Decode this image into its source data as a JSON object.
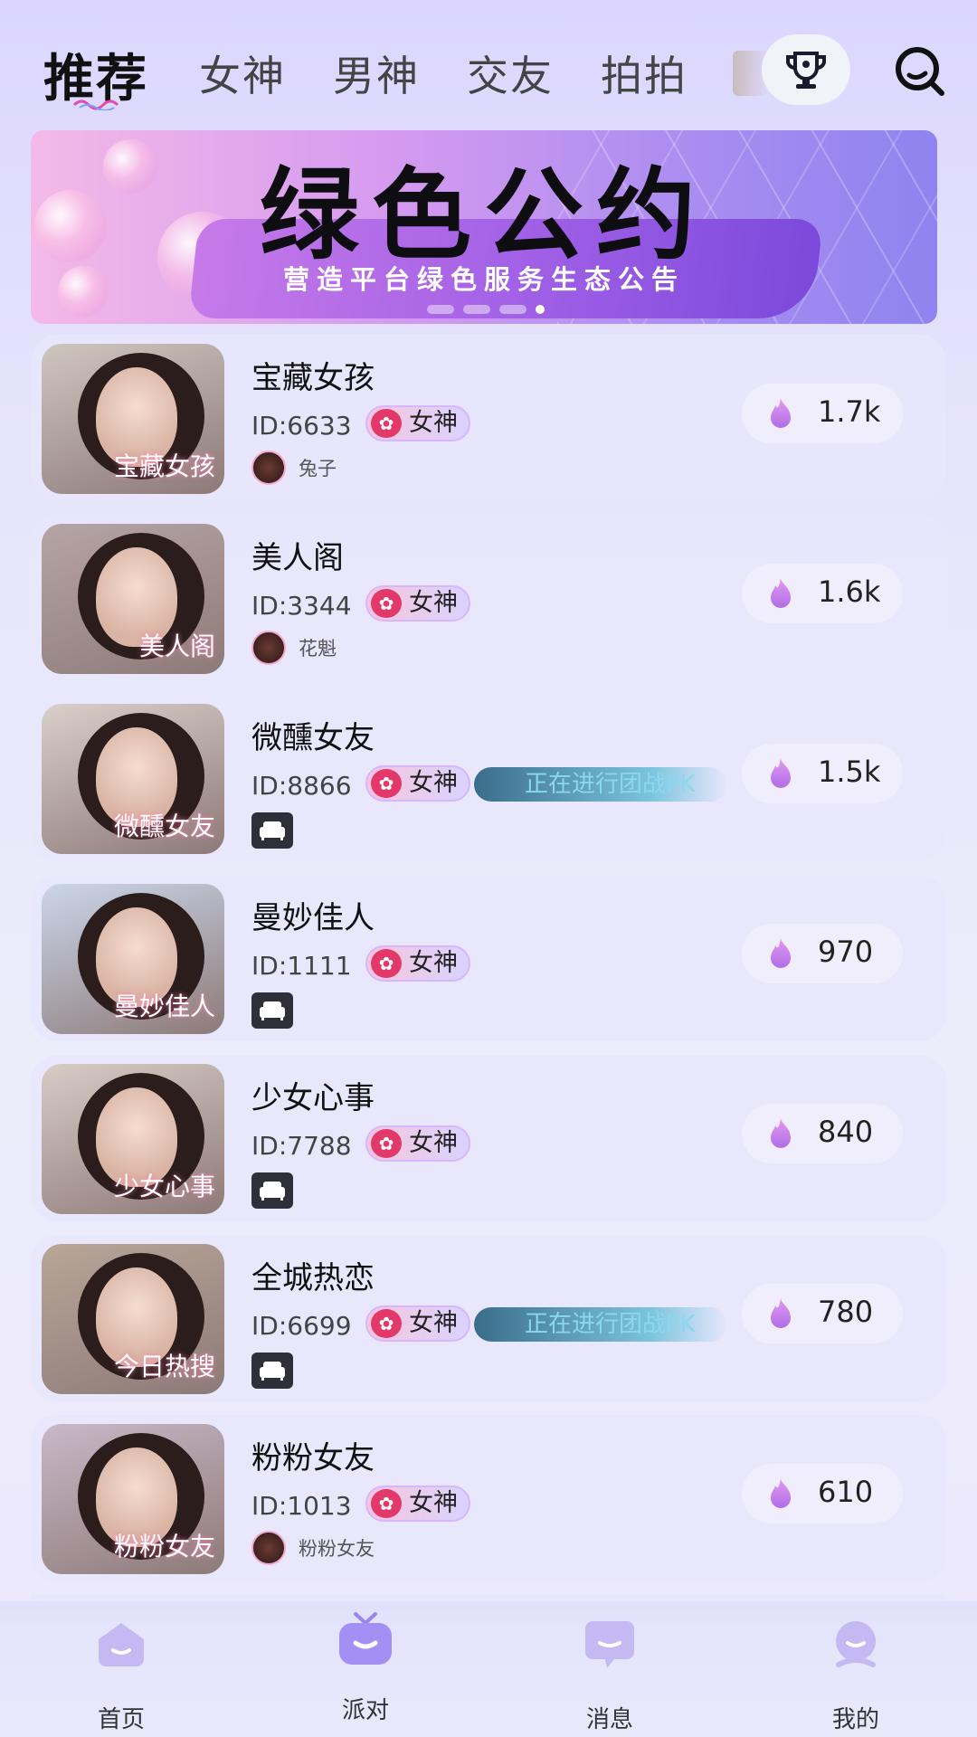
{
  "top_nav": {
    "tabs": [
      {
        "label": "推荐",
        "active": true
      },
      {
        "label": "女神",
        "active": false
      },
      {
        "label": "男神",
        "active": false
      },
      {
        "label": "交友",
        "active": false
      },
      {
        "label": "拍拍",
        "active": false
      }
    ],
    "icons": {
      "rank": "trophy-icon",
      "search": "search-icon"
    }
  },
  "banner": {
    "title": "绿色公约",
    "subtitle": "营造平台绿色服务生态公告",
    "pages": 4,
    "current_page": 4
  },
  "rooms": [
    {
      "name": "宝藏女孩",
      "id": "ID:6633",
      "tag": "女神",
      "host": "兔子",
      "pk": "",
      "heat": "1.7k",
      "cover_text": "宝藏女孩",
      "cover_color": "#cfc6c0"
    },
    {
      "name": "美人阁",
      "id": "ID:3344",
      "tag": "女神",
      "host": "花魁",
      "pk": "",
      "heat": "1.6k",
      "cover_text": "美人阁",
      "cover_color": "#b7a5a6"
    },
    {
      "name": "微醺女友",
      "id": "ID:8866",
      "tag": "女神",
      "host": "",
      "pk": "正在进行团战PK",
      "heat": "1.5k",
      "cover_text": "微醺女友",
      "cover_color": "#d9cfcb"
    },
    {
      "name": "曼妙佳人",
      "id": "ID:1111",
      "tag": "女神",
      "host": "",
      "pk": "",
      "heat": "970",
      "cover_text": "曼妙佳人",
      "cover_color": "#cbd6ea"
    },
    {
      "name": "少女心事",
      "id": "ID:7788",
      "tag": "女神",
      "host": "",
      "pk": "",
      "heat": "840",
      "cover_text": "少女心事",
      "cover_color": "#d8ccc6"
    },
    {
      "name": "全城热恋",
      "id": "ID:6699",
      "tag": "女神",
      "host": "",
      "pk": "正在进行团战PK",
      "heat": "780",
      "cover_text": "今日热搜",
      "cover_color": "#b9a698"
    },
    {
      "name": "粉粉女友",
      "id": "ID:1013",
      "tag": "女神",
      "host": "粉粉女友",
      "pk": "",
      "heat": "610",
      "cover_text": "粉粉女友",
      "cover_color": "#c9b8c8"
    }
  ],
  "bottom_nav": [
    {
      "label": "首页",
      "icon": "home-icon",
      "active": false
    },
    {
      "label": "派对",
      "icon": "party-tv-icon",
      "active": true
    },
    {
      "label": "消息",
      "icon": "message-icon",
      "active": false
    },
    {
      "label": "我的",
      "icon": "profile-icon",
      "active": false
    }
  ],
  "colors": {
    "accent": "#a88cf0",
    "tag_heart": "#e2386a",
    "flame": "#c77ae9"
  }
}
